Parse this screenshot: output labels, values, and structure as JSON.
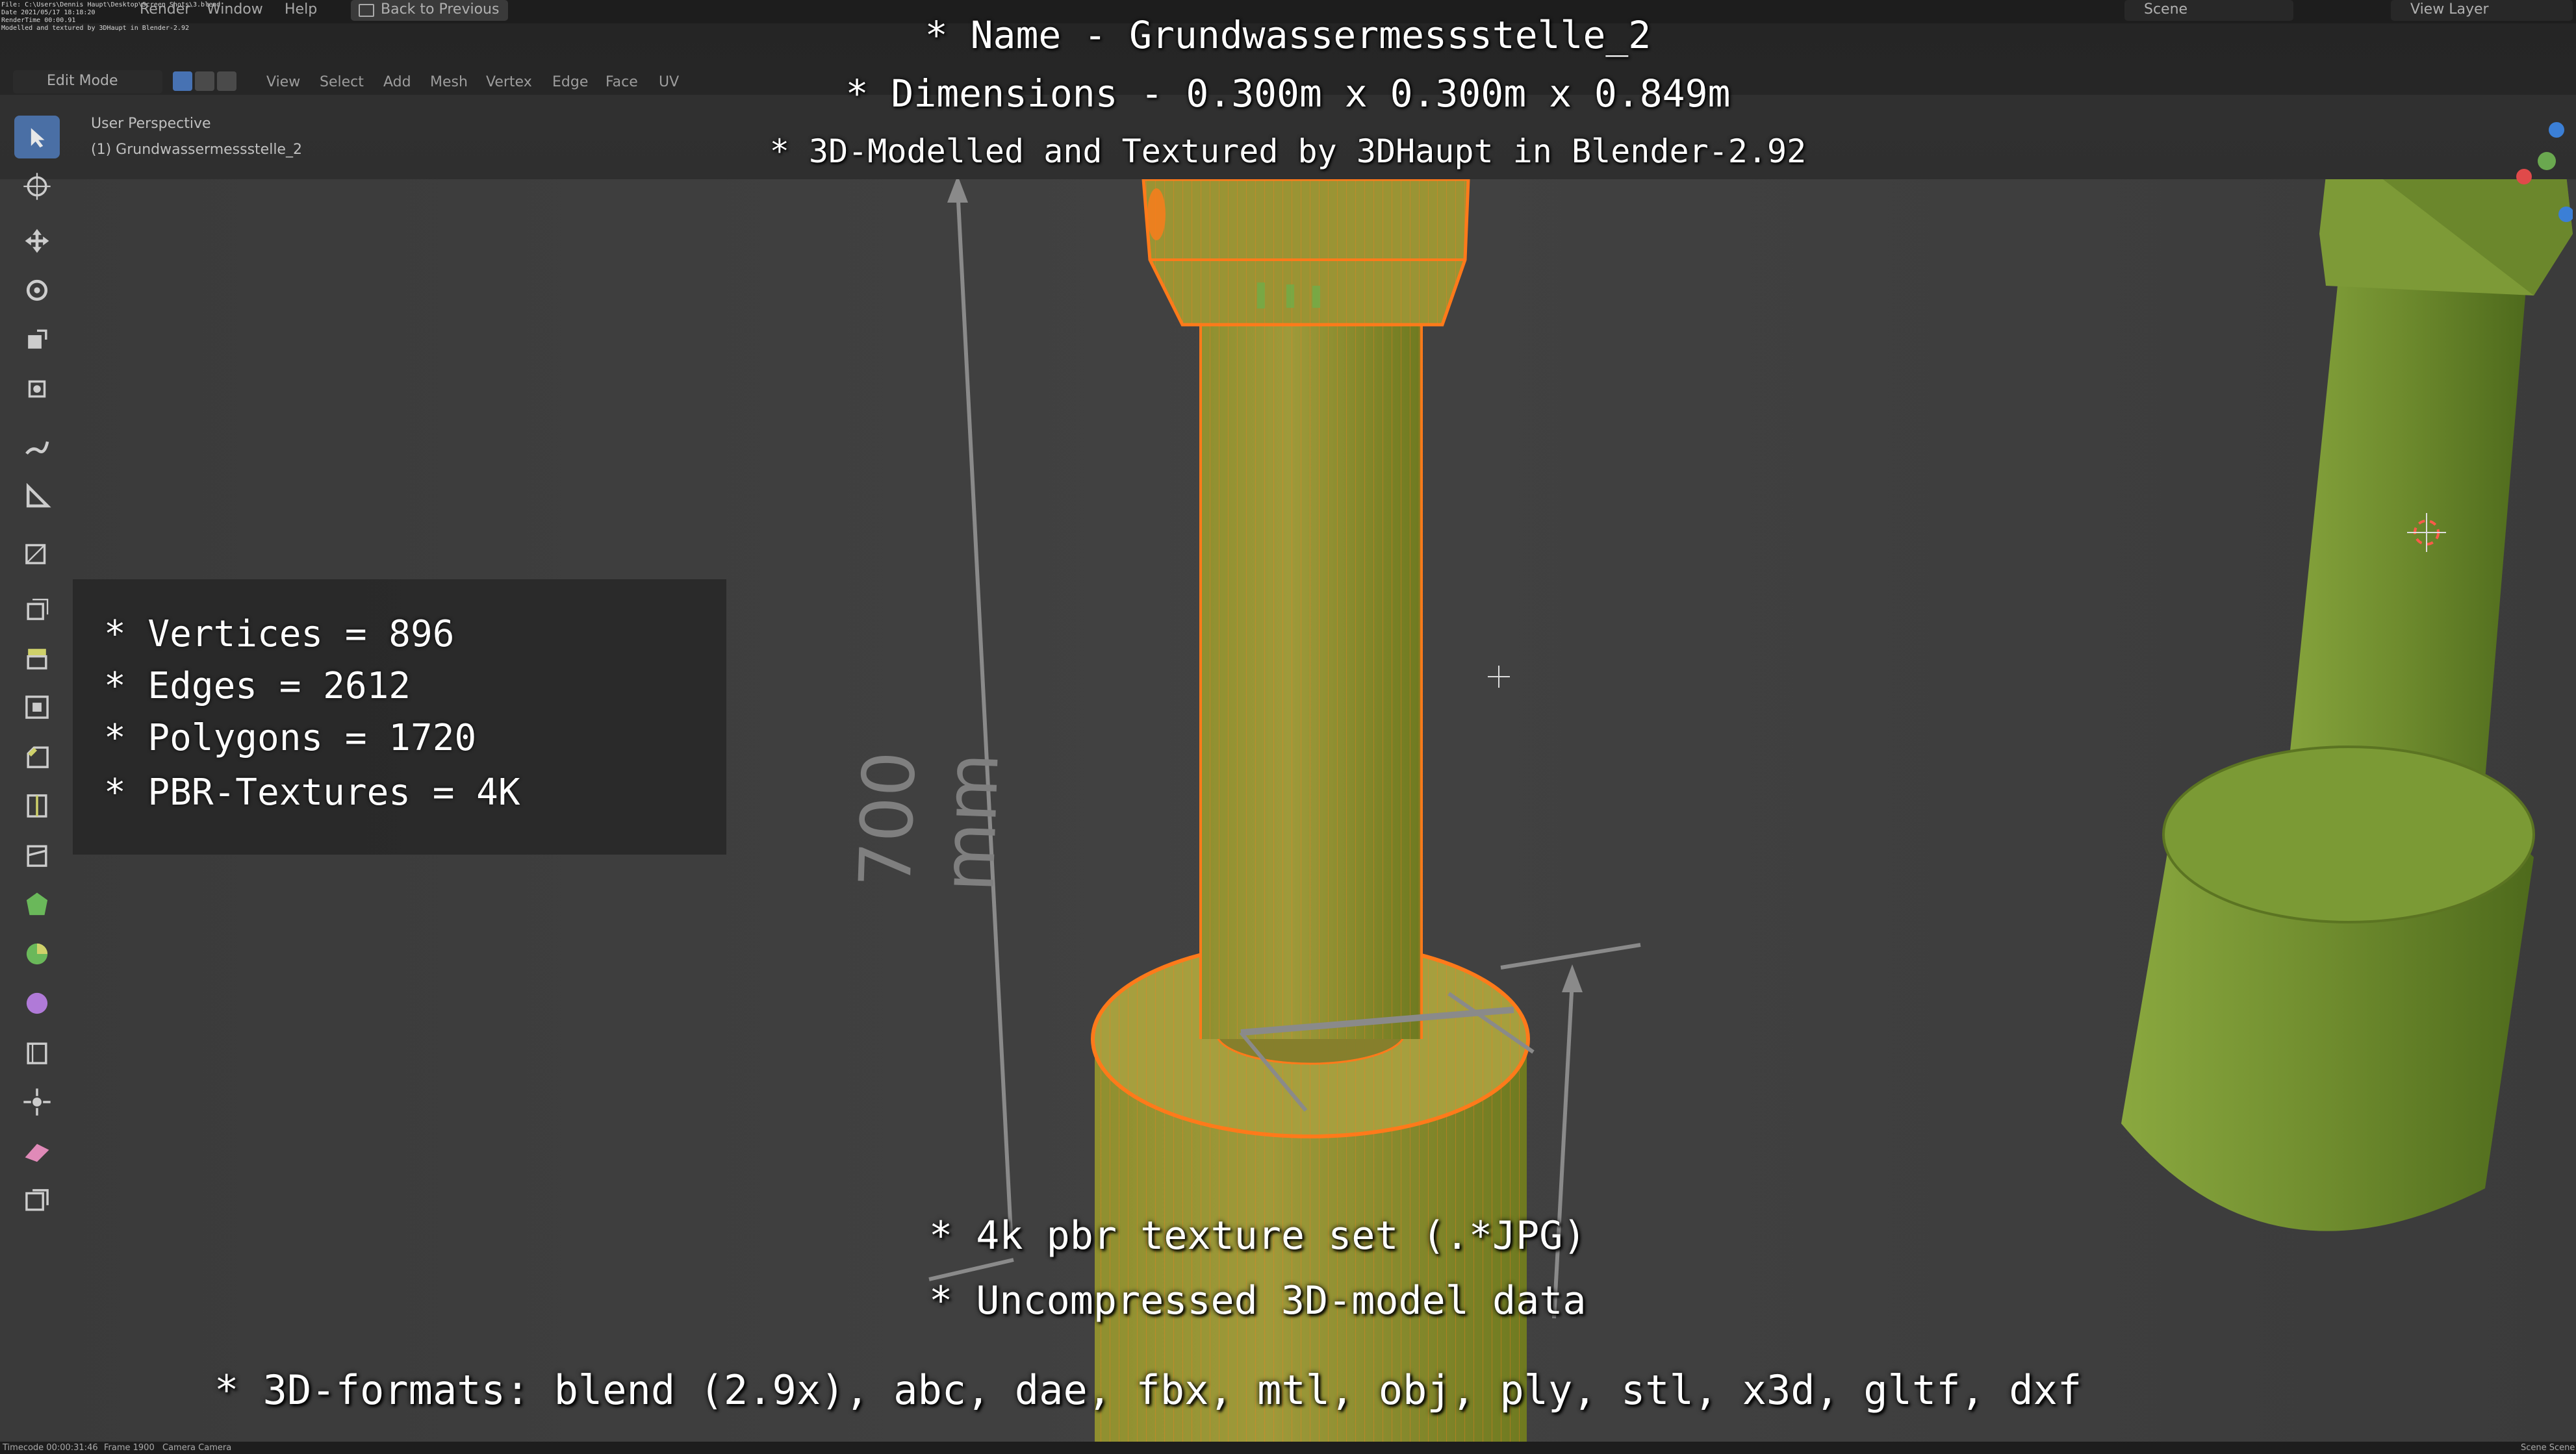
{
  "topbar": {
    "info_lines": "File: C:\\Users\\Dennis Haupt\\Desktop\\Screen Shots\\3.blend\nDate 2021/05/17 18:18:20\nRenderTime 00:00.91\nModelled and textured by 3DHaupt in Blender-2.92",
    "menu_help": "Help",
    "menu_render": "Render",
    "menu_window": "Window",
    "back_button": "Back to Previous",
    "scene_label": "Scene",
    "view_layer_label": "View Layer"
  },
  "header": {
    "mode": "Edit Mode",
    "menus": [
      "View",
      "Select",
      "Add",
      "Mesh",
      "Vertex",
      "Edge",
      "Face",
      "UV"
    ]
  },
  "viewport_info": {
    "perspective": "User Perspective",
    "object": "(1) Grundwassermessstelle_2"
  },
  "overlay": {
    "name_line": "* Name - Grundwassermessstelle_2",
    "dimensions_line": "* Dimensions -  0.300m x 0.300m x 0.849m",
    "credit_line": "* 3D-Modelled and Textured by 3DHaupt in Blender-2.92",
    "stats": [
      "* Vertices = 896",
      "* Edges = 2612",
      "* Polygons = 1720",
      "* PBR-Textures = 4K"
    ],
    "bottom_1": "* 4k pbr texture set (.*JPG)",
    "bottom_2": "* Uncompressed 3D-model data",
    "bottom_3": "* 3D-formats: blend (2.9x), abc, dae, fbx, mtl, obj, ply, stl, x3d, gltf, dxf"
  },
  "dimension_label": "700 mm",
  "statusbar": {
    "timecode": "Timecode 00:00:31:46",
    "frame": "Frame 1900",
    "camera": "Camera Camera",
    "scene_right": "Scene Scene"
  },
  "colors": {
    "viewport_bg": "#3d3d3d",
    "mesh_green": "#6b8a2a",
    "wire_orange": "#ff7a1a",
    "active_tool": "#4a6fa5"
  }
}
